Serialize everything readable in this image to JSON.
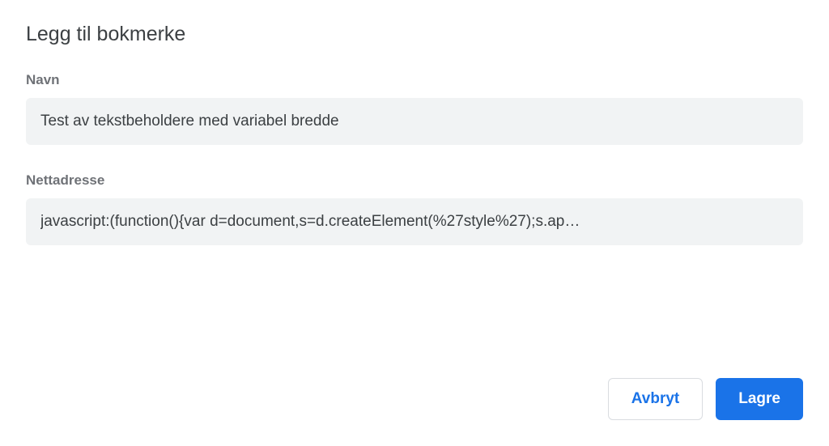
{
  "dialog": {
    "title": "Legg til bokmerke",
    "name": {
      "label": "Navn",
      "value": "Test av tekstbeholdere med variabel bredde"
    },
    "url": {
      "label": "Nettadresse",
      "value": "javascript:(function(){var d=document,s=d.createElement(%27style%27);s.ap…"
    },
    "buttons": {
      "cancel": "Avbryt",
      "save": "Lagre"
    }
  }
}
